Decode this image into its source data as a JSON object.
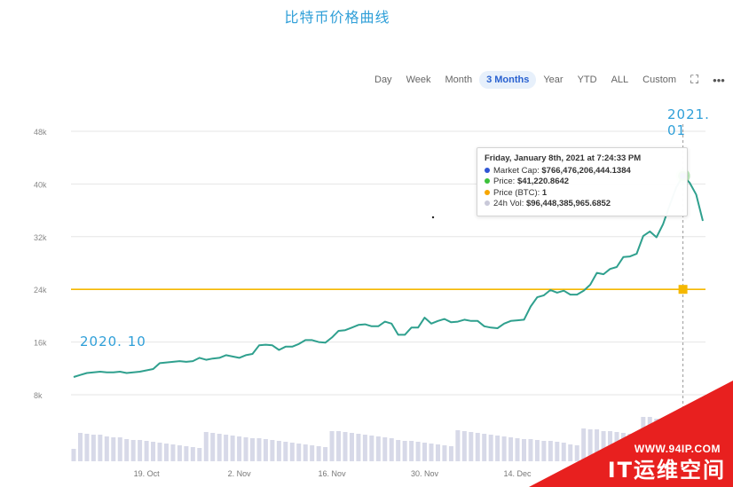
{
  "page": {
    "title": "比特币价格曲线"
  },
  "toolbar": {
    "ranges": [
      "Day",
      "Week",
      "Month",
      "3 Months",
      "Year",
      "YTD",
      "ALL",
      "Custom"
    ],
    "active": "3 Months",
    "fullscreen_icon": "fullscreen-icon",
    "more_icon": "more-options-icon"
  },
  "annotations": {
    "start": "2020. 10",
    "end": "2021. 01"
  },
  "tooltip": {
    "title": "Friday, January 8th, 2021 at 7:24:33 PM",
    "rows": [
      {
        "label": "Market Cap:",
        "value": "$766,476,206,444.1384",
        "color": "#2f55d4"
      },
      {
        "label": "Price:",
        "value": "$41,220.8642",
        "color": "#3cc13b"
      },
      {
        "label": "Price (BTC):",
        "value": "1",
        "color": "#f7a600"
      },
      {
        "label": "24h Vol:",
        "value": "$96,448,385,965.6852",
        "color": "#c9c9d9"
      }
    ]
  },
  "watermark": {
    "url": "WWW.94IP.COM",
    "brand": "IT运维空间"
  },
  "chart_data": {
    "type": "line",
    "x_tick_labels": [
      "19. Oct",
      "2. Nov",
      "16. Nov",
      "30. Nov",
      "14. Dec"
    ],
    "y_tick_labels": [
      "8k",
      "16k",
      "24k",
      "32k",
      "40k",
      "48k"
    ],
    "ylim": [
      4000,
      48000
    ],
    "grid": true,
    "reference_line": {
      "value": 24000,
      "color": "#f5b800"
    },
    "reference_marker": {
      "x": "2021-01-08",
      "value": 24000
    },
    "highlight": {
      "x": "2021-01-08",
      "value": 41220.86
    },
    "series": [
      {
        "color": "#2fa08e",
        "x": [
          "2020-10-08",
          "2020-10-09",
          "2020-10-10",
          "2020-10-11",
          "2020-10-12",
          "2020-10-13",
          "2020-10-14",
          "2020-10-15",
          "2020-10-16",
          "2020-10-17",
          "2020-10-18",
          "2020-10-19",
          "2020-10-20",
          "2020-10-21",
          "2020-10-22",
          "2020-10-23",
          "2020-10-24",
          "2020-10-25",
          "2020-10-26",
          "2020-10-27",
          "2020-10-28",
          "2020-10-29",
          "2020-10-30",
          "2020-10-31",
          "2020-11-01",
          "2020-11-02",
          "2020-11-03",
          "2020-11-04",
          "2020-11-05",
          "2020-11-06",
          "2020-11-07",
          "2020-11-08",
          "2020-11-09",
          "2020-11-10",
          "2020-11-11",
          "2020-11-12",
          "2020-11-13",
          "2020-11-14",
          "2020-11-15",
          "2020-11-16",
          "2020-11-17",
          "2020-11-18",
          "2020-11-19",
          "2020-11-20",
          "2020-11-21",
          "2020-11-22",
          "2020-11-23",
          "2020-11-24",
          "2020-11-25",
          "2020-11-26",
          "2020-11-27",
          "2020-11-28",
          "2020-11-29",
          "2020-11-30",
          "2020-12-01",
          "2020-12-02",
          "2020-12-03",
          "2020-12-04",
          "2020-12-05",
          "2020-12-06",
          "2020-12-07",
          "2020-12-08",
          "2020-12-09",
          "2020-12-10",
          "2020-12-11",
          "2020-12-12",
          "2020-12-13",
          "2020-12-14",
          "2020-12-15",
          "2020-12-16",
          "2020-12-17",
          "2020-12-18",
          "2020-12-19",
          "2020-12-20",
          "2020-12-21",
          "2020-12-22",
          "2020-12-23",
          "2020-12-24",
          "2020-12-25",
          "2020-12-26",
          "2020-12-27",
          "2020-12-28",
          "2020-12-29",
          "2020-12-30",
          "2020-12-31",
          "2021-01-01",
          "2021-01-02",
          "2021-01-03",
          "2021-01-04",
          "2021-01-05",
          "2021-01-06",
          "2021-01-07",
          "2021-01-08",
          "2021-01-09",
          "2021-01-10",
          "2021-01-11"
        ],
        "values": [
          10700,
          11000,
          11300,
          11400,
          11500,
          11400,
          11400,
          11500,
          11300,
          11400,
          11500,
          11700,
          11900,
          12800,
          12900,
          13000,
          13100,
          13000,
          13100,
          13600,
          13300,
          13500,
          13600,
          14000,
          13800,
          13600,
          14000,
          14200,
          15500,
          15600,
          15500,
          14800,
          15300,
          15300,
          15700,
          16300,
          16300,
          16000,
          15900,
          16700,
          17700,
          17800,
          18200,
          18600,
          18700,
          18400,
          18400,
          19100,
          18800,
          17100,
          17100,
          18200,
          18200,
          19700,
          18800,
          19200,
          19500,
          19000,
          19100,
          19400,
          19200,
          19200,
          18400,
          18200,
          18100,
          18800,
          19200,
          19300,
          19400,
          21400,
          22800,
          23100,
          23900,
          23500,
          23800,
          23200,
          23200,
          23800,
          24700,
          26500,
          26300,
          27100,
          27400,
          28900,
          29000,
          29400,
          32100,
          32800,
          31900,
          33900,
          36800,
          39500,
          41220,
          40200,
          38400,
          34400
        ]
      }
    ],
    "volume_bars": true
  }
}
